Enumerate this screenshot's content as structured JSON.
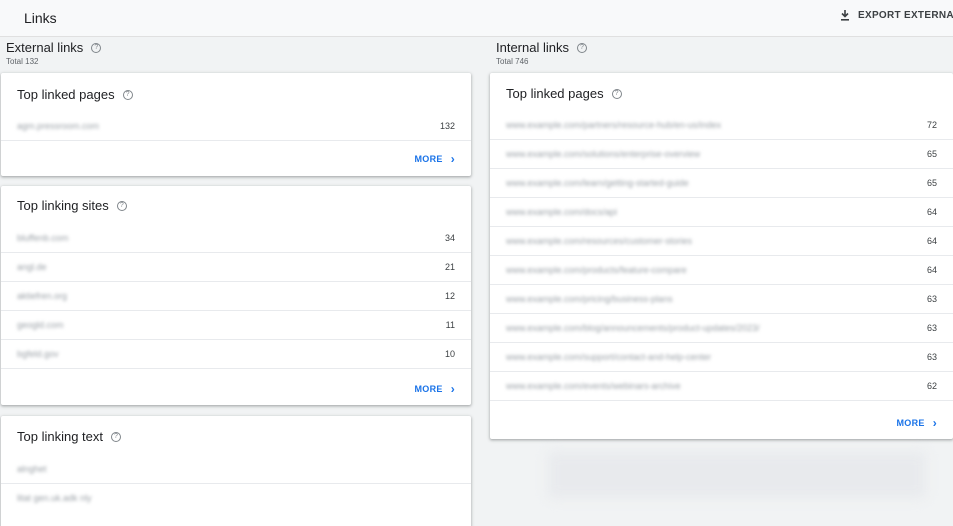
{
  "header": {
    "title": "Links",
    "export_label": "EXPORT EXTERNAL LINKS"
  },
  "external": {
    "heading": "External links",
    "total": "Total 132",
    "top_linked_pages": {
      "title": "Top linked pages",
      "rows": [
        {
          "label": "agm.pressroom.com",
          "value": "132"
        }
      ],
      "more": "MORE"
    },
    "top_linking_sites": {
      "title": "Top linking sites",
      "rows": [
        {
          "label": "bluffenb.com",
          "value": "34"
        },
        {
          "label": "angl.de",
          "value": "21"
        },
        {
          "label": "aktiefren.org",
          "value": "12"
        },
        {
          "label": "geogld.com",
          "value": "11"
        },
        {
          "label": "bgfeld.gov",
          "value": "10"
        }
      ],
      "more": "MORE"
    },
    "top_linking_text": {
      "title": "Top linking text",
      "rows": [
        {
          "label": "alnghet"
        },
        {
          "label": "litat gen.uk.adk nly"
        }
      ]
    }
  },
  "internal": {
    "heading": "Internal links",
    "total": "Total 746",
    "top_linked_pages": {
      "title": "Top linked pages",
      "rows": [
        {
          "label": "www.example.com/partners/resource-hub/en-us/index",
          "value": "72"
        },
        {
          "label": "www.example.com/solutions/enterprise-overview",
          "value": "65"
        },
        {
          "label": "www.example.com/learn/getting-started-guide",
          "value": "65"
        },
        {
          "label": "www.example.com/docs/api",
          "value": "64"
        },
        {
          "label": "www.example.com/resources/customer-stories",
          "value": "64"
        },
        {
          "label": "www.example.com/products/feature-compare",
          "value": "64"
        },
        {
          "label": "www.example.com/pricing/business-plans",
          "value": "63"
        },
        {
          "label": "www.example.com/blog/announcements/product-updates/2023/",
          "value": "63"
        },
        {
          "label": "www.example.com/support/contact-and-help-center",
          "value": "63"
        },
        {
          "label": "www.example.com/events/webinars-archive",
          "value": "62"
        }
      ],
      "more": "MORE"
    }
  },
  "colors": {
    "accent": "#1a73e8",
    "background": "#f1f3f4",
    "card": "#ffffff"
  }
}
